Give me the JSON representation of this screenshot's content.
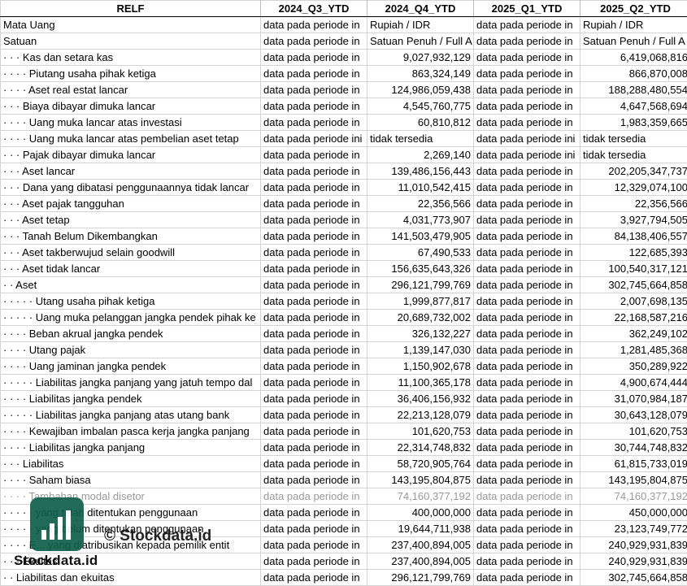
{
  "headers": [
    "RELF",
    "2024_Q3_YTD",
    "2024_Q4_YTD",
    "2025_Q1_YTD",
    "2025_Q2_YTD"
  ],
  "rows": [
    [
      "Mata Uang",
      "data pada periode in",
      "Rupiah / IDR",
      "data pada periode in",
      "Rupiah / IDR"
    ],
    [
      "Satuan",
      "data pada periode in",
      "Satuan Penuh / Full A",
      "data pada periode in",
      "Satuan Penuh / Full A"
    ],
    [
      "· · · Kas dan setara kas",
      "data pada periode in",
      "9,027,932,129",
      "data pada periode in",
      "6,419,068,816"
    ],
    [
      "· · · · Piutang usaha pihak ketiga",
      "data pada periode in",
      "863,324,149",
      "data pada periode in",
      "866,870,008"
    ],
    [
      "· · · · Aset real estat lancar",
      "data pada periode in",
      "124,986,059,438",
      "data pada periode in",
      "188,288,480,554"
    ],
    [
      "· · · Biaya dibayar dimuka lancar",
      "data pada periode in",
      "4,545,760,775",
      "data pada periode in",
      "4,647,568,694"
    ],
    [
      "· · · · Uang muka lancar atas investasi",
      "data pada periode in",
      "60,810,812",
      "data pada periode in",
      "1,983,359,665"
    ],
    [
      "· · · · Uang muka lancar atas pembelian aset tetap",
      "data pada periode ini",
      "tidak tersedia",
      "data pada periode ini",
      "tidak tersedia"
    ],
    [
      "· · · Pajak dibayar dimuka lancar",
      "data pada periode in",
      "2,269,140",
      "data pada periode ini",
      "tidak tersedia"
    ],
    [
      "· · · Aset lancar",
      "data pada periode in",
      "139,486,156,443",
      "data pada periode in",
      "202,205,347,737"
    ],
    [
      "· · · Dana yang dibatasi penggunaannya tidak lancar",
      "data pada periode in",
      "11,010,542,415",
      "data pada periode in",
      "12,329,074,100"
    ],
    [
      "· · · Aset pajak tangguhan",
      "data pada periode in",
      "22,356,566",
      "data pada periode in",
      "22,356,566"
    ],
    [
      "· · · Aset tetap",
      "data pada periode in",
      "4,031,773,907",
      "data pada periode in",
      "3,927,794,505"
    ],
    [
      "· · · Tanah Belum Dikembangkan",
      "data pada periode in",
      "141,503,479,905",
      "data pada periode in",
      "84,138,406,557"
    ],
    [
      "· · · Aset takberwujud selain goodwill",
      "data pada periode in",
      "67,490,533",
      "data pada periode in",
      "122,685,393"
    ],
    [
      "· · · Aset tidak lancar",
      "data pada periode in",
      "156,635,643,326",
      "data pada periode in",
      "100,540,317,121"
    ],
    [
      "· · Aset",
      "data pada periode in",
      "296,121,799,769",
      "data pada periode in",
      "302,745,664,858"
    ],
    [
      "· · · · · Utang usaha pihak ketiga",
      "data pada periode in",
      "1,999,877,817",
      "data pada periode in",
      "2,007,698,135"
    ],
    [
      "· · · · · Uang muka pelanggan jangka pendek pihak ke",
      "data pada periode in",
      "20,689,732,002",
      "data pada periode in",
      "22,168,587,216"
    ],
    [
      "· · · · Beban akrual jangka pendek",
      "data pada periode in",
      "326,132,227",
      "data pada periode in",
      "362,249,102"
    ],
    [
      "· · · · Utang pajak",
      "data pada periode in",
      "1,139,147,030",
      "data pada periode in",
      "1,281,485,368"
    ],
    [
      "· · · · Uang jaminan jangka pendek",
      "data pada periode in",
      "1,150,902,678",
      "data pada periode in",
      "350,289,922"
    ],
    [
      "· · · · · Liabilitas jangka panjang yang jatuh tempo dal",
      "data pada periode in",
      "11,100,365,178",
      "data pada periode in",
      "4,900,674,444"
    ],
    [
      "· · · · Liabilitas jangka pendek",
      "data pada periode in",
      "36,406,156,932",
      "data pada periode in",
      "31,070,984,187"
    ],
    [
      "· · · · · Liabilitas jangka panjang atas utang bank",
      "data pada periode in",
      "22,213,128,079",
      "data pada periode in",
      "30,643,128,079"
    ],
    [
      "· · · · Kewajiban imbalan pasca kerja jangka panjang",
      "data pada periode in",
      "101,620,753",
      "data pada periode in",
      "101,620,753"
    ],
    [
      "· · · · Liabilitas jangka panjang",
      "data pada periode in",
      "22,314,748,832",
      "data pada periode in",
      "30,744,748,832"
    ],
    [
      "· · · Liabilitas",
      "data pada periode in",
      "58,720,905,764",
      "data pada periode in",
      "61,815,733,019"
    ],
    [
      "· · · · Saham biasa",
      "data pada periode in",
      "143,195,804,875",
      "data pada periode in",
      "143,195,804,875"
    ],
    [
      "· · · · Tambahan modal disetor",
      "data pada periode in",
      "74,160,377,192",
      "data pada periode in",
      "74,160,377,192"
    ],
    [
      "· · · · · yang telah ditentukan penggunaan",
      "data pada periode in",
      "400,000,000",
      "data pada periode in",
      "450,000,000"
    ],
    [
      "· · · · · yang belum ditentukan penggunaan",
      "data pada periode in",
      "19,644,711,938",
      "data pada periode in",
      "23,123,749,772"
    ],
    [
      "· · · · E... yang diatribusikan kepada pemilik entit",
      "data pada periode in",
      "237,400,894,005",
      "data pada periode in",
      "240,929,931,839"
    ],
    [
      "· · · Ekuitas",
      "data pada periode in",
      "237,400,894,005",
      "data pada periode in",
      "240,929,931,839"
    ],
    [
      "· · Liabilitas dan ekuitas",
      "data pada periode in",
      "296,121,799,769",
      "data pada periode in",
      "302,745,664,858"
    ]
  ],
  "watermark": {
    "text": "© Stockdata.id",
    "logo_text": "Stockdata.id",
    "logo_color": "#0f5f4a"
  }
}
